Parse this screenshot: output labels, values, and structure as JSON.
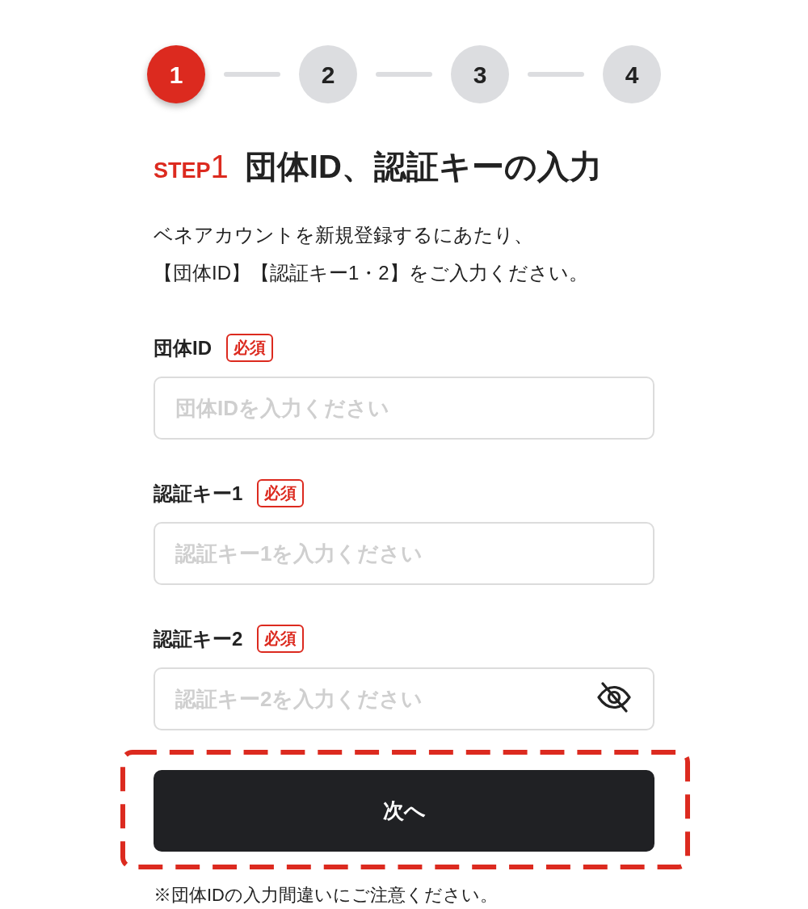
{
  "steps": [
    {
      "label": "1",
      "selected": true
    },
    {
      "label": "2",
      "selected": false
    },
    {
      "label": "3",
      "selected": false
    },
    {
      "label": "4",
      "selected": false
    }
  ],
  "heading": {
    "step_prefix": "STEP",
    "step_number": "1",
    "title": "団体ID、認証キーの入力"
  },
  "description": [
    "ベネアカウントを新規登録するにあたり、",
    "【団体ID】【認証キー1・2】をご入力ください。"
  ],
  "fields": [
    {
      "kind": "text",
      "label": "団体ID",
      "badge": "必須",
      "placeholder": "団体IDを入力ください"
    },
    {
      "kind": "text",
      "label": "認証キー1",
      "badge": "必須",
      "placeholder": "認証キー1を入力ください"
    },
    {
      "kind": "password",
      "label": "認証キー2",
      "badge": "必須",
      "placeholder": "認証キー2を入力ください"
    }
  ],
  "next_button": {
    "label": "次へ",
    "highlighted": true
  },
  "note": "※団体IDの入力間違いにご注意ください。"
}
